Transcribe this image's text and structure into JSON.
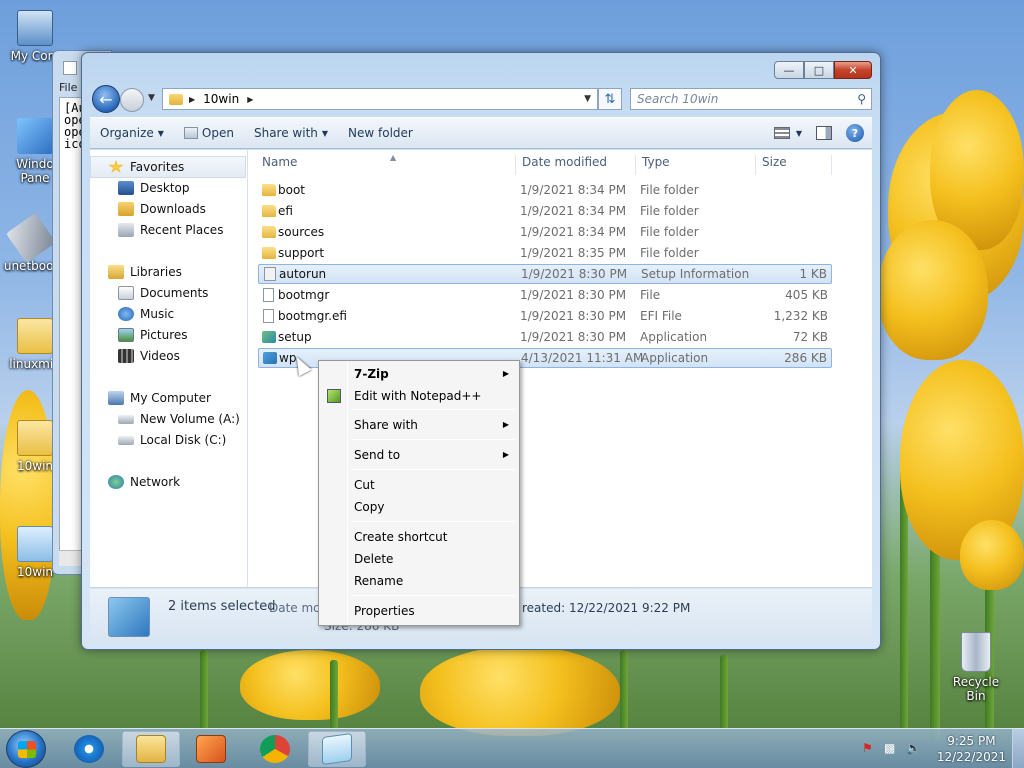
{
  "desktop": {
    "icons": [
      {
        "label": "My Com",
        "name": "my-computer-desktop-icon"
      },
      {
        "label": "Windo\nPane",
        "name": "windows-panel-desktop-icon"
      },
      {
        "label": "unetboot",
        "name": "unetbootin-desktop-icon"
      },
      {
        "label": "linuxmin",
        "name": "linuxmint-iso-desktop-icon"
      },
      {
        "label": "10win",
        "name": "10win-iso-desktop-icon"
      },
      {
        "label": "10win",
        "name": "10win-folder-desktop-icon"
      },
      {
        "label": "Recycle Bin",
        "name": "recycle-bin-desktop-icon"
      }
    ]
  },
  "back_window": {
    "menu": "File",
    "lines": [
      "[Au",
      "ope",
      "ope",
      "ico"
    ]
  },
  "explorer": {
    "address": {
      "path": "10win",
      "search_placeholder": "Search 10win"
    },
    "toolbar": {
      "organize": "Organize",
      "open": "Open",
      "share_with": "Share with",
      "new_folder": "New folder"
    },
    "nav": {
      "favorites": "Favorites",
      "desktop": "Desktop",
      "downloads": "Downloads",
      "recent_places": "Recent Places",
      "libraries": "Libraries",
      "documents": "Documents",
      "music": "Music",
      "pictures": "Pictures",
      "videos": "Videos",
      "my_computer": "My Computer",
      "new_volume": "New Volume (A:)",
      "local_disk": "Local Disk (C:)",
      "network": "Network"
    },
    "columns": {
      "name": "Name",
      "date": "Date modified",
      "type": "Type",
      "size": "Size"
    },
    "files": [
      {
        "name": "boot",
        "date": "1/9/2021 8:34 PM",
        "type": "File folder",
        "size": ""
      },
      {
        "name": "efi",
        "date": "1/9/2021 8:34 PM",
        "type": "File folder",
        "size": ""
      },
      {
        "name": "sources",
        "date": "1/9/2021 8:34 PM",
        "type": "File folder",
        "size": ""
      },
      {
        "name": "support",
        "date": "1/9/2021 8:35 PM",
        "type": "File folder",
        "size": ""
      },
      {
        "name": "autorun",
        "date": "1/9/2021 8:30 PM",
        "type": "Setup Information",
        "size": "1 KB"
      },
      {
        "name": "bootmgr",
        "date": "1/9/2021 8:30 PM",
        "type": "File",
        "size": "405 KB"
      },
      {
        "name": "bootmgr.efi",
        "date": "1/9/2021 8:30 PM",
        "type": "EFI File",
        "size": "1,232 KB"
      },
      {
        "name": "setup",
        "date": "1/9/2021 8:30 PM",
        "type": "Application",
        "size": "72 KB"
      },
      {
        "name": "wp",
        "date": "4/13/2021 11:31 AM",
        "type": "Application",
        "size": "286 KB"
      }
    ],
    "details": {
      "selected": "2 items selected",
      "date_mod_label": "Date mod",
      "created": "reated: 12/22/2021 9:22 PM",
      "size": "Size: 286 KB"
    }
  },
  "context_menu": {
    "seven_zip": "7-Zip",
    "edit_notepad": "Edit with Notepad++",
    "share_with": "Share with",
    "send_to": "Send to",
    "cut": "Cut",
    "copy": "Copy",
    "create_shortcut": "Create shortcut",
    "delete": "Delete",
    "rename": "Rename",
    "properties": "Properties"
  },
  "taskbar": {
    "time": "9:25 PM",
    "date": "12/22/2021"
  },
  "colors": {
    "accent": "#2a66b8",
    "selection": "#d1e3f6",
    "taskbar": "#6d8fb3"
  }
}
